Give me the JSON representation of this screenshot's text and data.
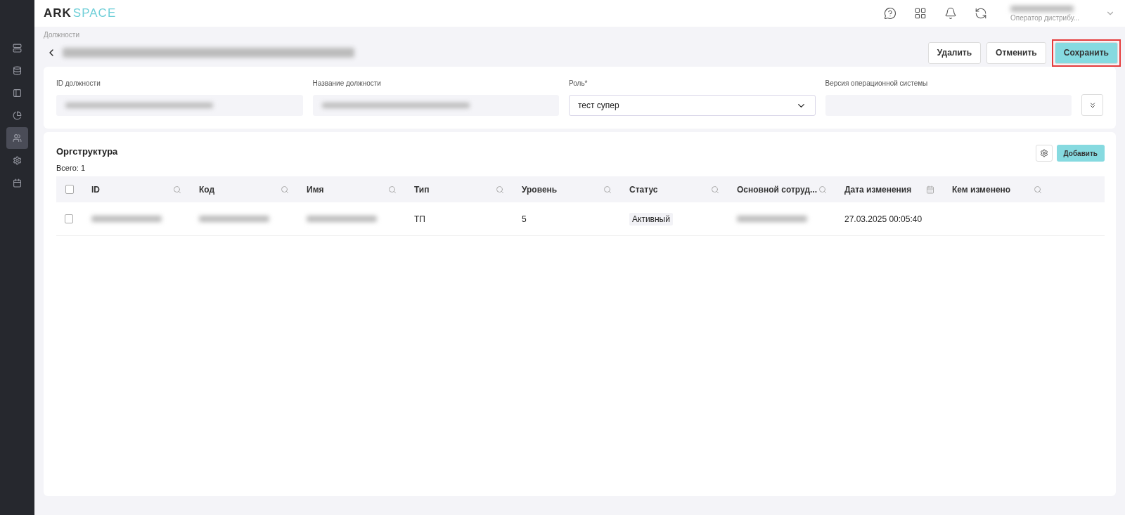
{
  "logo": {
    "dark": "ARK",
    "light": "SPACE"
  },
  "sidebar": {
    "items": [
      {
        "selected": false
      },
      {
        "selected": false
      },
      {
        "selected": false
      },
      {
        "selected": false
      },
      {
        "selected": true
      },
      {
        "selected": false
      },
      {
        "selected": false
      }
    ]
  },
  "header": {
    "user": {
      "role": "Оператор дистрибу..."
    }
  },
  "breadcrumb": "Должности",
  "actions": [
    {
      "label": "Удалить",
      "primary": false,
      "highlighted": false
    },
    {
      "label": "Отменить",
      "primary": false,
      "highlighted": false
    },
    {
      "label": "Сохранить",
      "primary": true,
      "highlighted": true
    }
  ],
  "fields": [
    {
      "label": "ID должности",
      "kind": "redacted"
    },
    {
      "label": "Название должности",
      "kind": "redacted"
    },
    {
      "label": "Роль*",
      "kind": "select",
      "value": "тест супер"
    },
    {
      "label": "Версия операционной системы",
      "kind": "empty"
    }
  ],
  "table": {
    "title": "Оргструктура",
    "all_checked": false,
    "total": "Всего: 1",
    "add_button": "Добавить",
    "columns": [
      {
        "label": "ID",
        "kind": "search"
      },
      {
        "label": "Код",
        "kind": "search"
      },
      {
        "label": "Имя",
        "kind": "search"
      },
      {
        "label": "Тип",
        "kind": "search"
      },
      {
        "label": "Уровень",
        "kind": "search"
      },
      {
        "label": "Статус",
        "kind": "search"
      },
      {
        "label": "Основной сотруд...",
        "kind": "search"
      },
      {
        "label": "Дата изменения",
        "kind": "date"
      },
      {
        "label": "Кем изменено",
        "kind": "search"
      }
    ],
    "rows": [
      {
        "checked": false,
        "cells": [
          {
            "kind": "redacted"
          },
          {
            "kind": "redacted"
          },
          {
            "kind": "redacted"
          },
          {
            "kind": "text",
            "text": "ТП"
          },
          {
            "kind": "text",
            "text": "5"
          },
          {
            "kind": "badge",
            "text": "Активный"
          },
          {
            "kind": "redacted"
          },
          {
            "kind": "text",
            "text": "27.03.2025 00:05:40"
          },
          {
            "kind": "empty"
          }
        ]
      }
    ]
  }
}
